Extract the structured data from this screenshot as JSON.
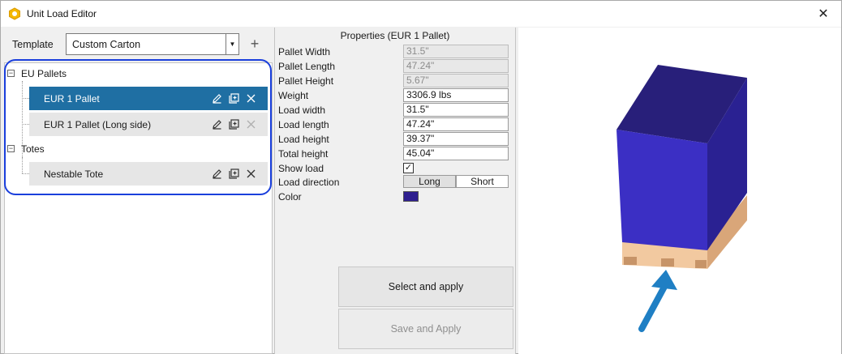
{
  "window": {
    "title": "Unit Load Editor",
    "close_glyph": "✕",
    "icon": "app-logo-icon"
  },
  "template": {
    "label": "Template",
    "selected": "Custom Carton",
    "add_glyph": "+"
  },
  "tree": {
    "groups": [
      {
        "label": "EU Pallets",
        "expander": "−",
        "items": [
          {
            "label": "EUR 1 Pallet",
            "selected": true
          },
          {
            "label": "EUR 1 Pallet (Long side)",
            "selected": false
          }
        ]
      },
      {
        "label": "Totes",
        "expander": "−",
        "items": [
          {
            "label": "Nestable Tote",
            "selected": false
          }
        ]
      }
    ]
  },
  "properties": {
    "title": "Properties (EUR 1 Pallet)",
    "rows": [
      {
        "label": "Pallet Width",
        "value": "31.5\""
      },
      {
        "label": "Pallet Length",
        "value": "47.24\""
      },
      {
        "label": "Pallet Height",
        "value": "5.67\""
      },
      {
        "label": "Weight",
        "value": "3306.9 lbs"
      },
      {
        "label": "Load width",
        "value": "31.5\""
      },
      {
        "label": "Load length",
        "value": "47.24\""
      },
      {
        "label": "Load height",
        "value": "39.37\""
      },
      {
        "label": "Total height",
        "value": "45.04\""
      }
    ],
    "show_load": {
      "label": "Show load",
      "checked": "✓"
    },
    "load_direction": {
      "label": "Load direction",
      "options": [
        "Long",
        "Short"
      ],
      "selected": "Long"
    },
    "color": {
      "label": "Color",
      "value": "#2e1f8f"
    },
    "select_apply_label": "Select and apply",
    "save_apply_label": "Save and Apply"
  },
  "viewport": {
    "load_color": "#2e1f8f",
    "pallet_color": "#e8b98c",
    "arrow_color": "#1f7fc4"
  }
}
